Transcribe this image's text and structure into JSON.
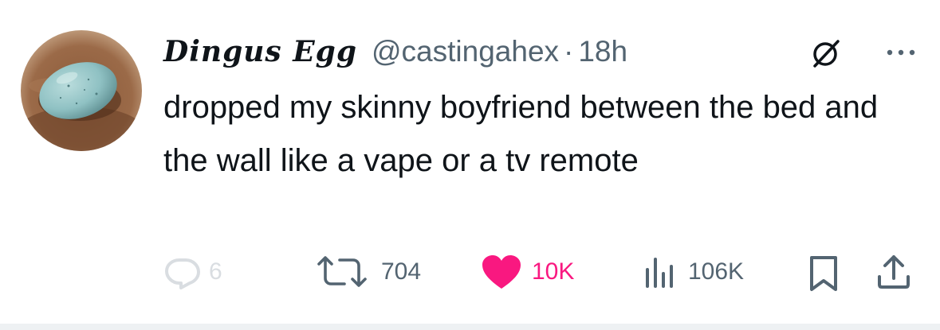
{
  "author": {
    "display_name": "Dingus Egg",
    "handle": "@castingahex",
    "separator": "·",
    "time": "18h"
  },
  "tweet": {
    "text": "dropped my skinny boyfriend between the bed and the wall like a vape or a tv remote"
  },
  "actions": {
    "replies": "6",
    "retweets": "704",
    "likes": "10K",
    "views": "106K"
  },
  "icons": {
    "avatar": "egg-avatar",
    "grok": "grok-icon",
    "more": "more-icon",
    "reply": "reply-icon",
    "retweet": "retweet-icon",
    "like": "heart-icon",
    "views": "views-icon",
    "bookmark": "bookmark-icon",
    "share": "share-icon"
  },
  "colors": {
    "text": "#0f1419",
    "secondary": "#536471",
    "like": "#f91880",
    "reply_muted": "#d9dde1"
  }
}
